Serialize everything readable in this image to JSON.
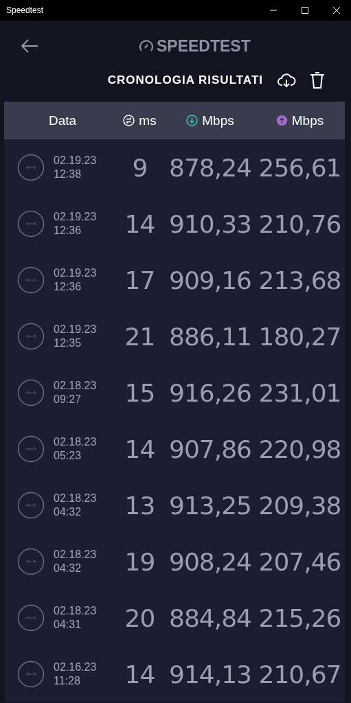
{
  "window": {
    "title": "Speedtest"
  },
  "app": {
    "logo": "SPEEDTEST",
    "title": "CRONOLOGIA RISULTATI"
  },
  "table": {
    "columns": [
      {
        "kind": "date",
        "label": "Data"
      },
      {
        "kind": "ping",
        "label": "ms"
      },
      {
        "kind": "download",
        "label": "Mbps"
      },
      {
        "kind": "upload",
        "label": "Mbps"
      }
    ],
    "rows": [
      {
        "date": "02.19.23",
        "time": "12:38",
        "ping": "9",
        "download": "878,24",
        "upload": "256,61"
      },
      {
        "date": "02.19.23",
        "time": "12:36",
        "ping": "14",
        "download": "910,33",
        "upload": "210,76"
      },
      {
        "date": "02.19.23",
        "time": "12:36",
        "ping": "17",
        "download": "909,16",
        "upload": "213,68"
      },
      {
        "date": "02.19.23",
        "time": "12:35",
        "ping": "21",
        "download": "886,11",
        "upload": "180,27"
      },
      {
        "date": "02.18.23",
        "time": "09:27",
        "ping": "15",
        "download": "916,26",
        "upload": "231,01"
      },
      {
        "date": "02.18.23",
        "time": "05:23",
        "ping": "14",
        "download": "907,86",
        "upload": "220,98"
      },
      {
        "date": "02.18.23",
        "time": "04:32",
        "ping": "13",
        "download": "913,25",
        "upload": "209,38"
      },
      {
        "date": "02.18.23",
        "time": "04:32",
        "ping": "19",
        "download": "908,24",
        "upload": "207,46"
      },
      {
        "date": "02.18.23",
        "time": "04:31",
        "ping": "20",
        "download": "884,84",
        "upload": "215,26"
      },
      {
        "date": "02.16.23",
        "time": "11:28",
        "ping": "14",
        "download": "914,13",
        "upload": "210,67"
      }
    ]
  }
}
